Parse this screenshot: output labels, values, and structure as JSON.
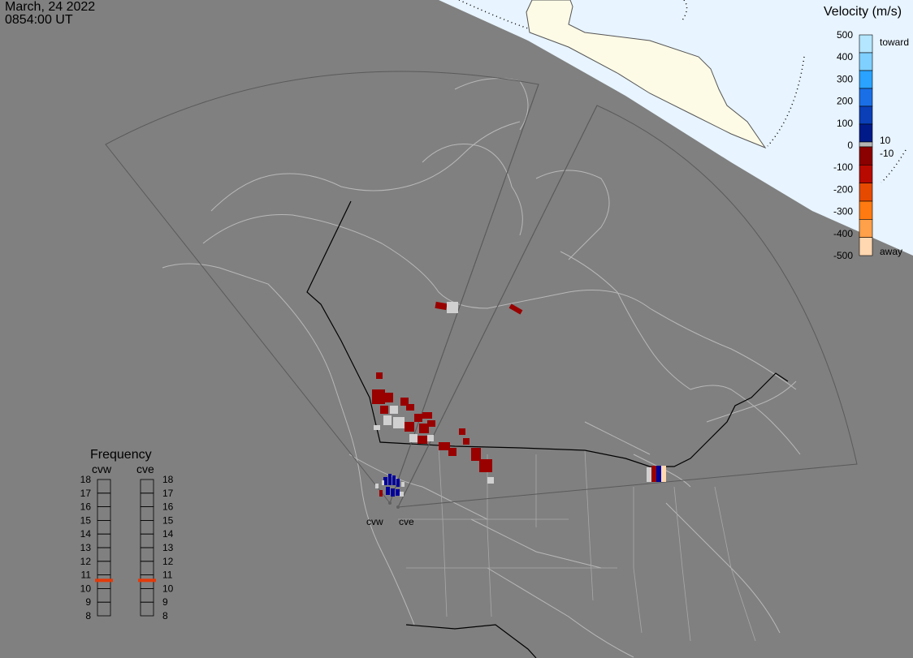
{
  "header": {
    "date": "March, 24 2022",
    "time": "0854:00 UT"
  },
  "velocity_scale": {
    "title": "Velocity (m/s)",
    "ticks": [
      "500",
      "400",
      "300",
      "200",
      "100",
      "0",
      "-100",
      "-200",
      "-300",
      "-400",
      "-500"
    ],
    "toward_label": "toward",
    "away_label": "away",
    "small_pos": "10",
    "small_neg": "-10",
    "colors": [
      "#b4e6ff",
      "#7fd0ff",
      "#2aa2ff",
      "#1a6fe6",
      "#0a3fb8",
      "#001a8a",
      "#b5b5b5",
      "#8b0000",
      "#b80a00",
      "#e64a00",
      "#ff7a10",
      "#ffa04a",
      "#ffd7b0"
    ]
  },
  "frequency_panel": {
    "title": "Frequency",
    "radars": [
      "cvw",
      "cve"
    ],
    "ticks": [
      "18",
      "17",
      "16",
      "15",
      "14",
      "13",
      "12",
      "11",
      "10",
      "9",
      "8"
    ],
    "values_mhz": [
      10.6,
      10.6
    ],
    "indicator_color": "#e23a0a"
  },
  "radar_labels": {
    "cvw": "cvw",
    "cve": "cve"
  },
  "colors": {
    "background": "#808080",
    "daylight_sky": "#e8f4ff",
    "land_daylight": "#fdfbe6",
    "coast": "#b5b5b5",
    "border": "#000000",
    "fov": "#5a5a5a",
    "echo_red": "#990000",
    "echo_blue": "#000099",
    "echo_gray": "#d0d0d0"
  }
}
